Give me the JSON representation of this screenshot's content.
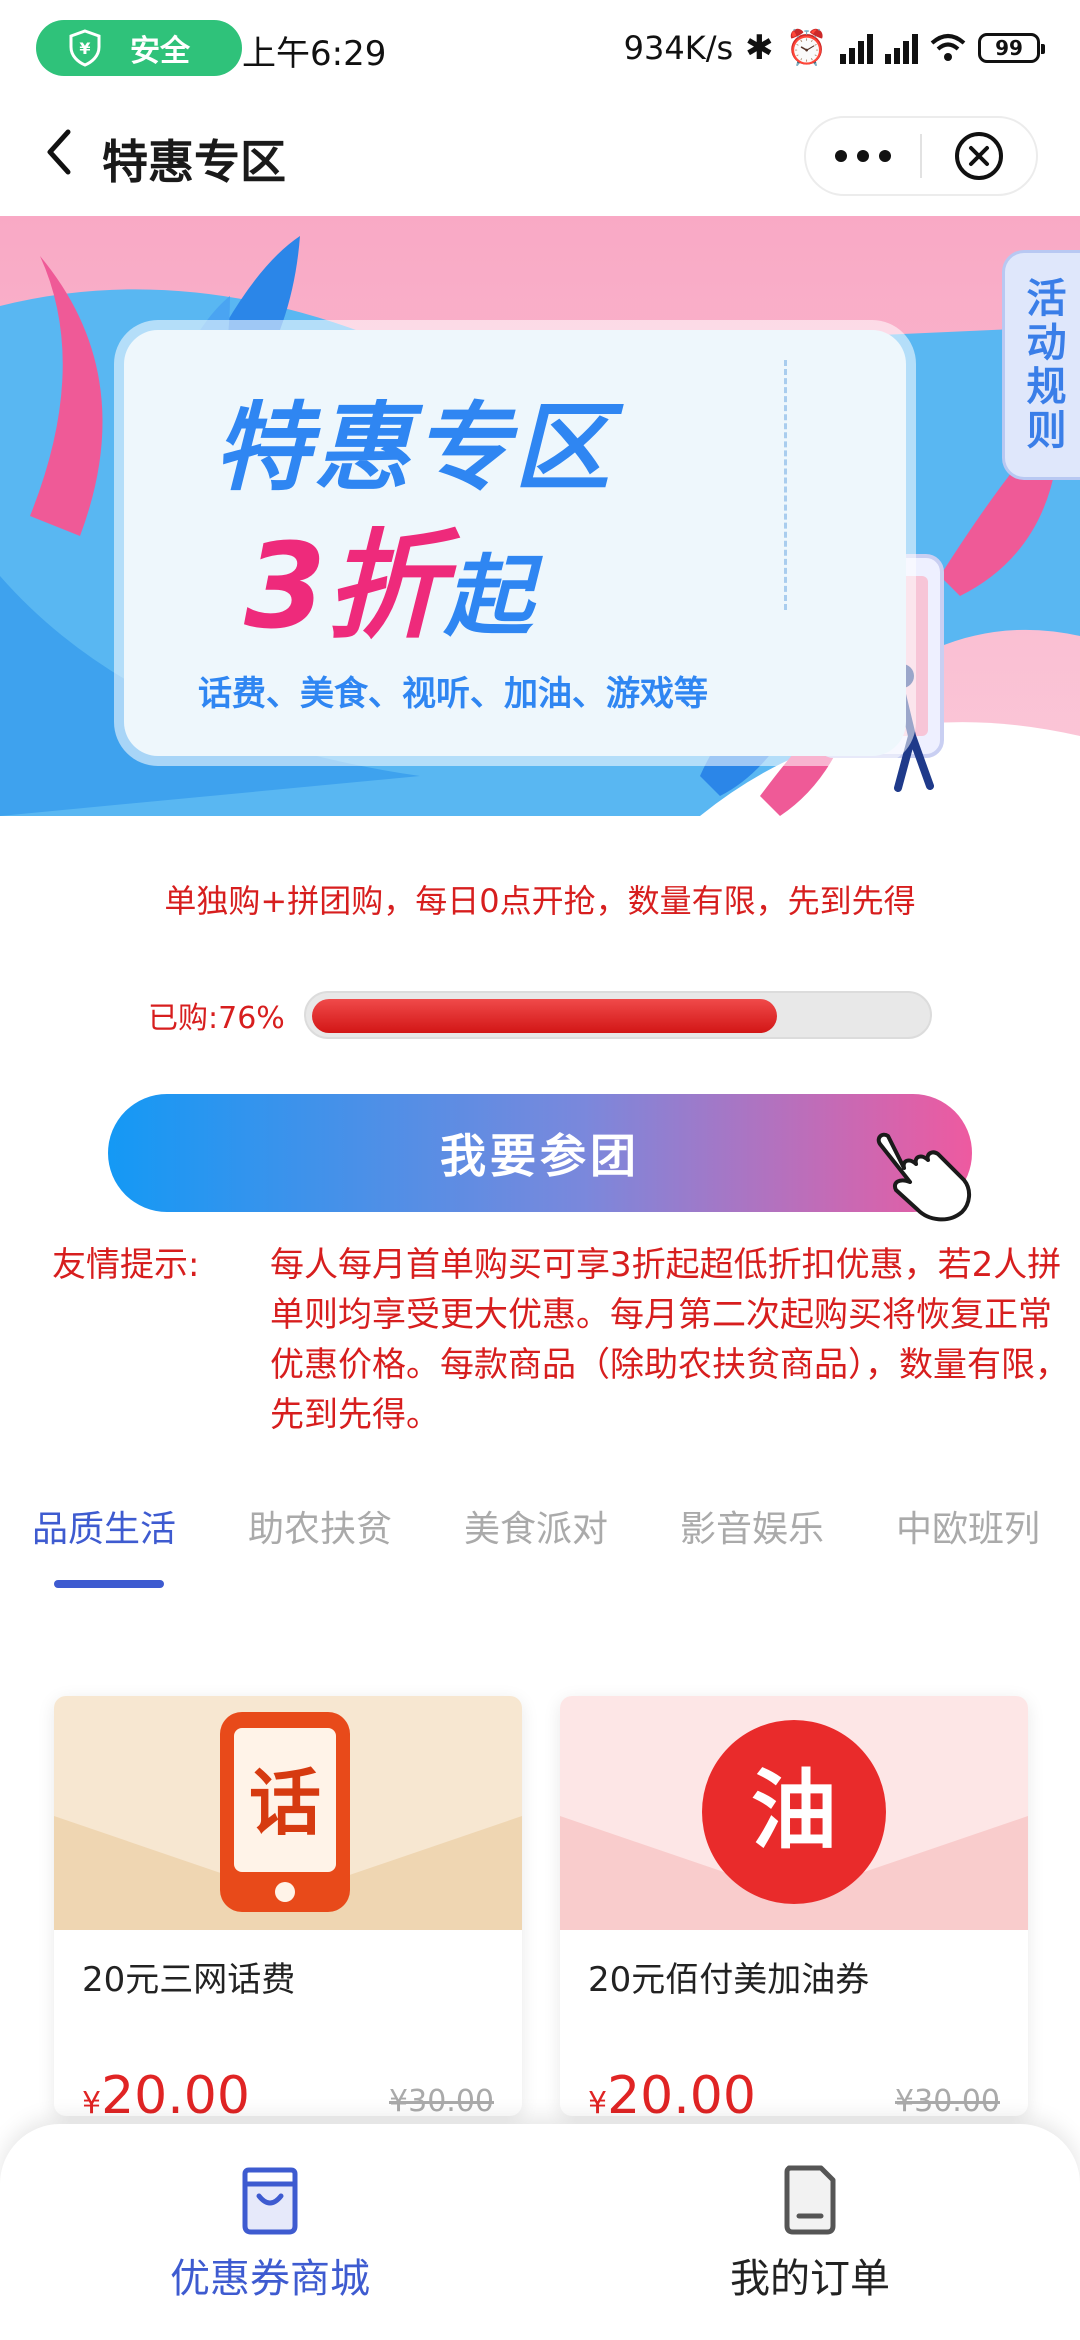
{
  "status_bar": {
    "safe_label": "安全",
    "time": "上午6:29",
    "net_speed": "934K/s",
    "signal_1": "5G",
    "signal_2": "5G",
    "battery": "99"
  },
  "header": {
    "title": "特惠专区"
  },
  "banner": {
    "rules_tab": "活动规则",
    "headline": "特惠专区",
    "discount_big": "3折",
    "discount_small": "起",
    "categories_line": "话费、美食、视听、加油、游戏等"
  },
  "promo": {
    "intro": "单独购+拼团购，每日0点开抢，数量有限，先到先得",
    "progress_label": "已购:76%",
    "progress_fraction": 0.76,
    "join_button": "我要参团",
    "tip_label": "友情提示:",
    "tip_body": "每人每月首单购买可享3折起超低折扣优惠，若2人拼单则均享受更大优惠。每月第二次起购买将恢复正常优惠价格。每款商品（除助农扶贫商品），数量有限，先到先得。"
  },
  "tabs": [
    {
      "label": "品质生活",
      "active": true
    },
    {
      "label": "助农扶贫",
      "active": false
    },
    {
      "label": "美食派对",
      "active": false
    },
    {
      "label": "影音娱乐",
      "active": false
    },
    {
      "label": "中欧班列",
      "active": false
    }
  ],
  "products": [
    {
      "name": "20元三网话费",
      "currency": "¥",
      "price": "20.00",
      "original_price": "¥30.00",
      "icon_char": "话"
    },
    {
      "name": "20元佰付美加油券",
      "currency": "¥",
      "price": "20.00",
      "original_price": "¥30.00",
      "icon_char": "油"
    }
  ],
  "bottom_nav": [
    {
      "label": "优惠券商城",
      "active": true
    },
    {
      "label": "我的订单",
      "active": false
    }
  ],
  "colors": {
    "accent_blue": "#3e5bd0",
    "promo_red": "#d71e1e",
    "safe_green": "#2fc27a"
  }
}
